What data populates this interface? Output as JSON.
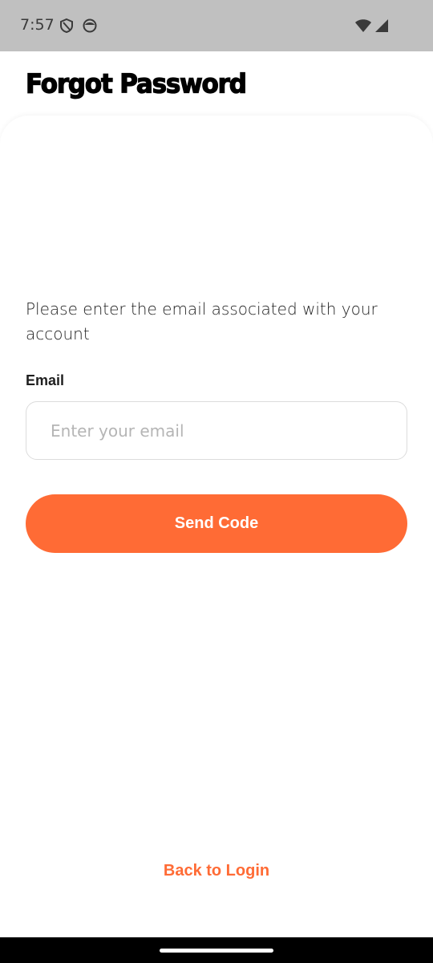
{
  "status_bar": {
    "time": "7:57",
    "left_icons": [
      "shield-icon",
      "face-icon"
    ],
    "right_icons": [
      "wifi-icon",
      "cell-signal-icon"
    ]
  },
  "header": {
    "title": "Forgot Password"
  },
  "form": {
    "description": "Please enter the email associated with your account",
    "email_label": "Email",
    "email_placeholder": "Enter your email",
    "email_value": "",
    "send_button_label": "Send Code"
  },
  "footer": {
    "back_link": "Back to Login"
  },
  "colors": {
    "accent": "#ff6b35",
    "status_bar_bg": "#c0c0c0",
    "nav_bar_bg": "#000000"
  }
}
